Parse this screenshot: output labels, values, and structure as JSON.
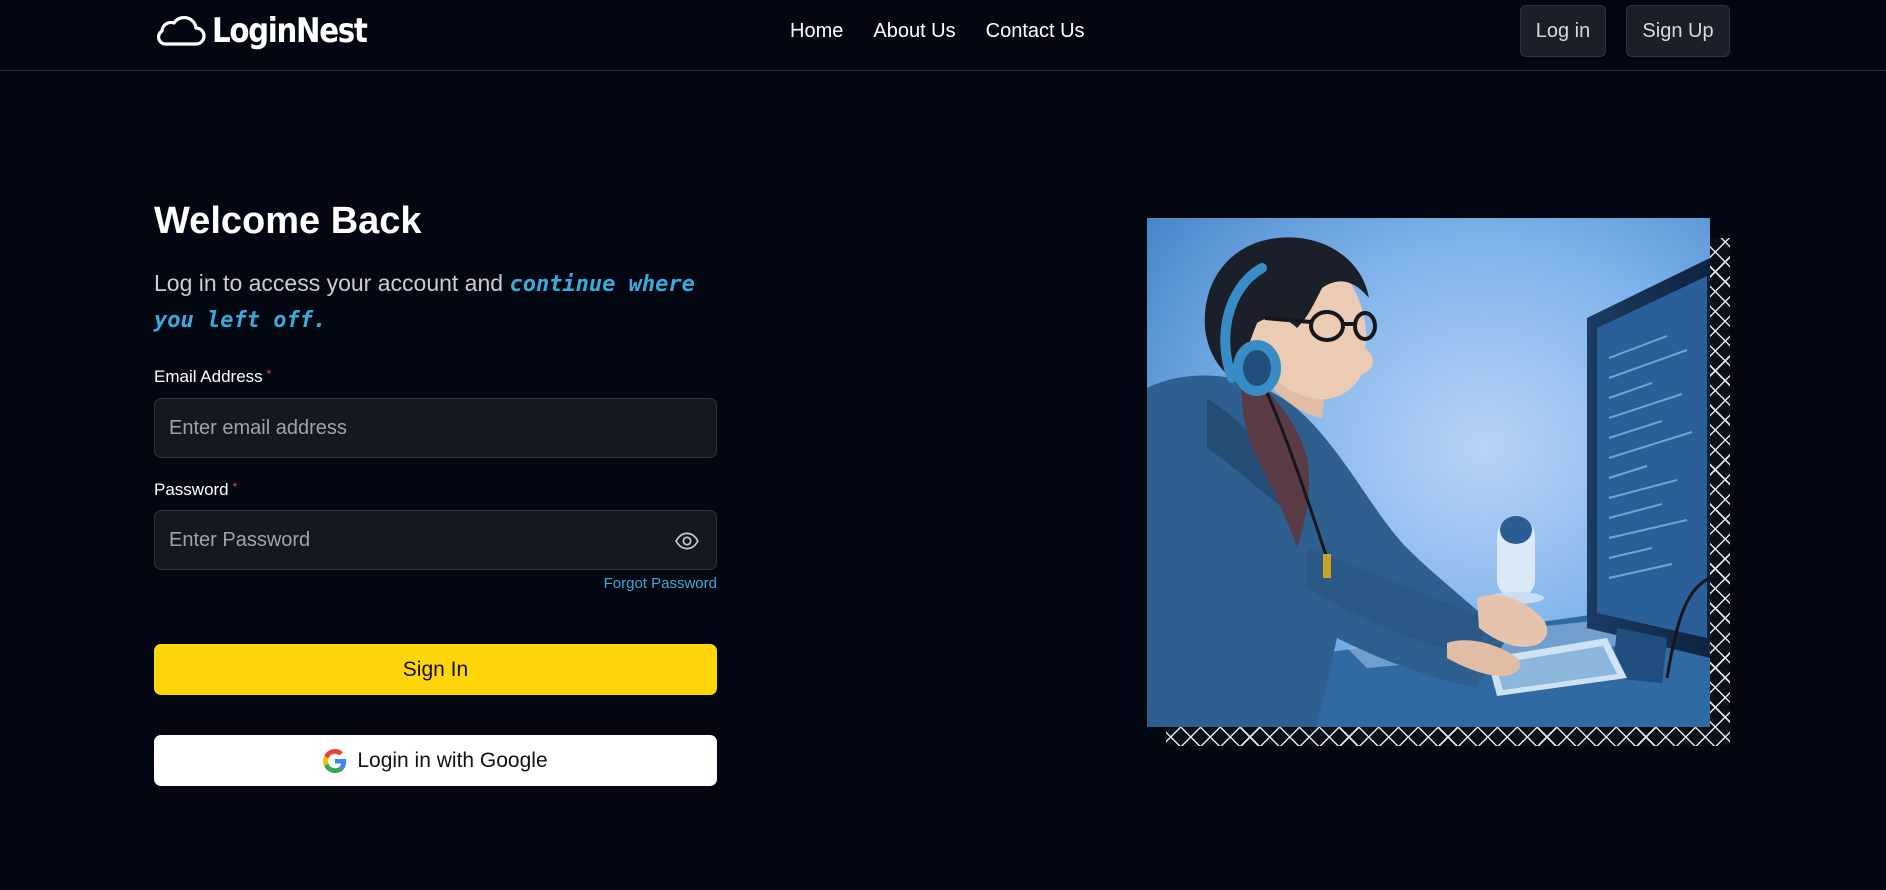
{
  "header": {
    "brand": "LoginNest",
    "nav": [
      "Home",
      "About Us",
      "Contact Us"
    ],
    "login_label": "Log in",
    "signup_label": "Sign Up"
  },
  "form": {
    "title": "Welcome Back",
    "subtitle_plain": "Log in to access your account and ",
    "subtitle_accent": "continue where you left off.",
    "email_label": "Email Address",
    "email_placeholder": "Enter email address",
    "email_value": "",
    "password_label": "Password",
    "password_placeholder": "Enter Password",
    "password_value": "",
    "required_mark": "*",
    "forgot_label": "Forgot Password",
    "signin_label": "Sign In",
    "google_label": "Login in with Google"
  },
  "colors": {
    "background": "#030712",
    "accent_yellow": "#ffd60a",
    "accent_blue": "#3ea8d8",
    "required_red": "#ef4444"
  },
  "icons": {
    "logo": "cloud-icon",
    "password_toggle": "eye-icon",
    "google": "google-icon"
  }
}
